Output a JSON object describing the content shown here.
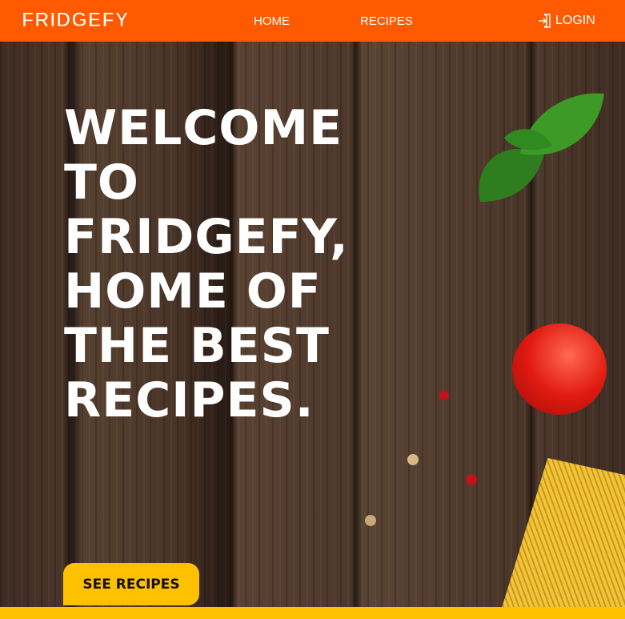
{
  "nav": {
    "logo": "FRIDGEFY",
    "links": [
      "HOME",
      "RECIPES"
    ],
    "login": "LOGIN"
  },
  "hero": {
    "title": "WELCOME TO FRIDGEFY, HOME OF THE BEST RECIPES.",
    "button": "SEE RECIPES"
  },
  "colors": {
    "nav": "#ff5a00",
    "accent": "#ffc000"
  }
}
